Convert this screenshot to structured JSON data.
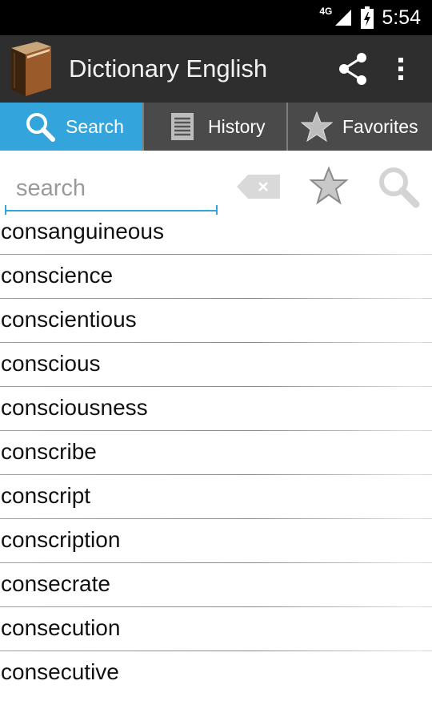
{
  "status_bar": {
    "network": "4G",
    "time": "5:54"
  },
  "app_bar": {
    "title": "Dictionary English",
    "icons": [
      "book-logo",
      "share-icon",
      "overflow-menu-icon"
    ]
  },
  "tabs": [
    {
      "label": "Search",
      "icon": "search-icon",
      "active": true
    },
    {
      "label": "History",
      "icon": "list-icon",
      "active": false
    },
    {
      "label": "Favorites",
      "icon": "star-icon",
      "active": false
    }
  ],
  "search": {
    "placeholder": "search",
    "value": "",
    "icons": [
      "clear-icon",
      "star-icon",
      "search-icon"
    ]
  },
  "words": [
    "consanguineous",
    "conscience",
    "conscientious",
    "conscious",
    "consciousness",
    "conscribe",
    "conscript",
    "conscription",
    "consecrate",
    "consecution",
    "consecutive"
  ],
  "colors": {
    "accent": "#33a5dc",
    "app_bar": "#2e2e2e",
    "tab_bar": "#4a4a4a",
    "status_bar": "#000000"
  }
}
